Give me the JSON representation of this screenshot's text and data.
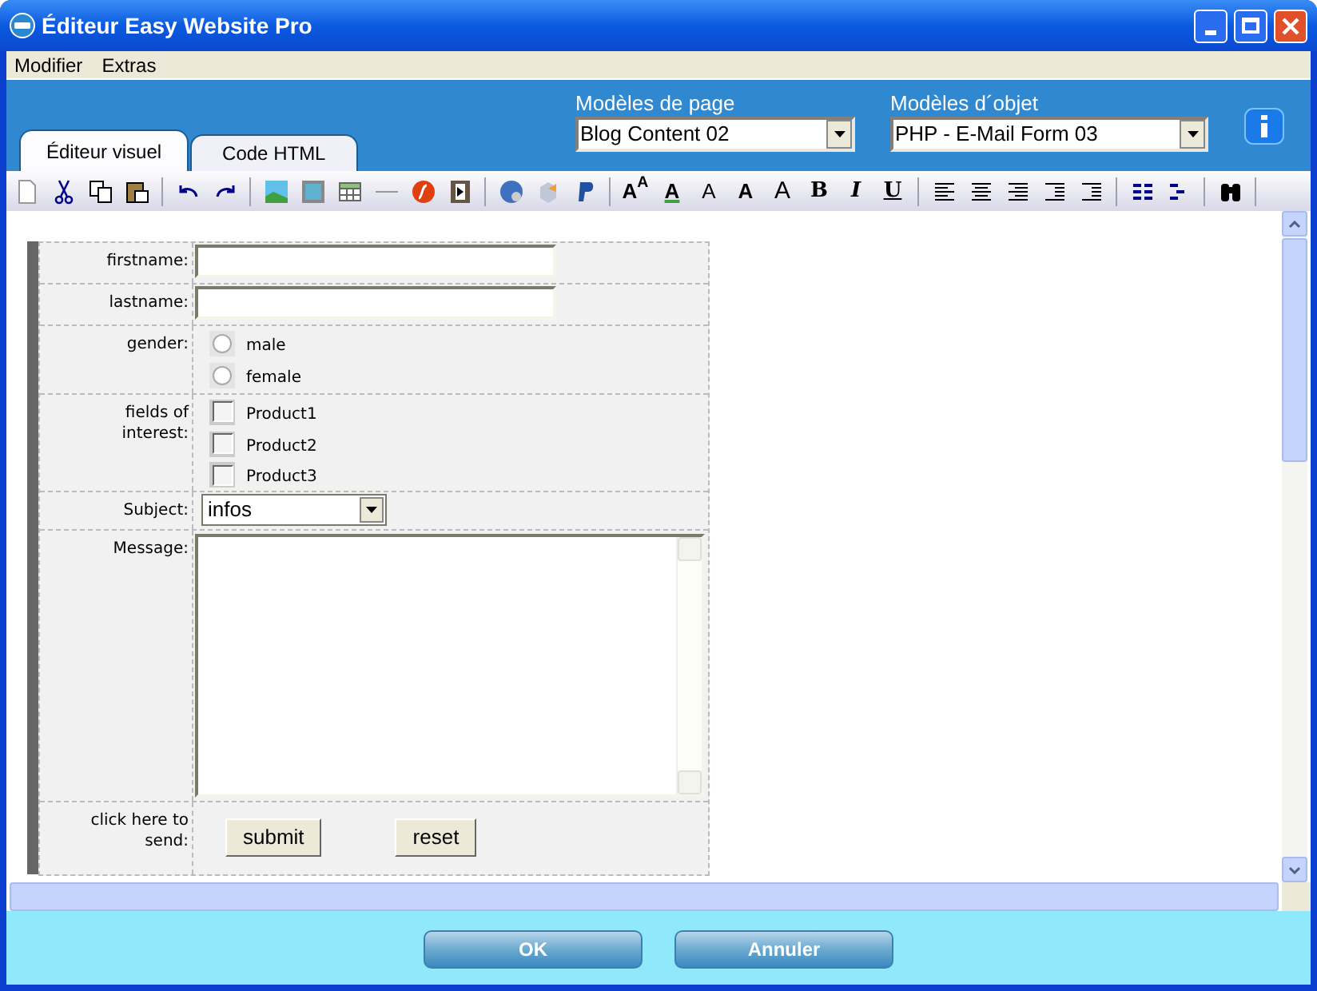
{
  "window": {
    "title": "Éditeur Easy Website Pro"
  },
  "menu": [
    "Modifier",
    "Extras"
  ],
  "tabs": [
    {
      "label": "Éditeur visuel",
      "selected": true
    },
    {
      "label": "Code HTML",
      "selected": false
    }
  ],
  "page_templates": {
    "label": "Modèles de page",
    "value": "Blog Content 02"
  },
  "object_templates": {
    "label": "Modèles d´objet",
    "value": "PHP - E-Mail Form 03"
  },
  "toolbar_letters": [
    "A$^{A}$",
    "A",
    "A",
    "A",
    "A",
    "B",
    "I",
    "U"
  ],
  "form": [
    {
      "kind": "text",
      "label": "firstname:"
    },
    {
      "kind": "text",
      "label": "lastname:"
    },
    {
      "kind": "radio",
      "label": "gender:",
      "options": [
        {
          "label": "male",
          "selected": false
        },
        {
          "label": "female",
          "selected": false
        }
      ]
    },
    {
      "kind": "checkbox",
      "label": "fields of interest:",
      "options": [
        {
          "label": "Product1",
          "checked": false
        },
        {
          "label": "Product2",
          "checked": false
        },
        {
          "label": "Product3",
          "checked": false
        }
      ]
    },
    {
      "kind": "select",
      "label": "Subject:",
      "value": "infos"
    },
    {
      "kind": "textarea",
      "label": "Message:"
    },
    {
      "kind": "buttons",
      "label": "click here to send:",
      "buttons": [
        "submit",
        "reset"
      ]
    }
  ],
  "buttons": [
    "OK",
    "Annuler"
  ]
}
